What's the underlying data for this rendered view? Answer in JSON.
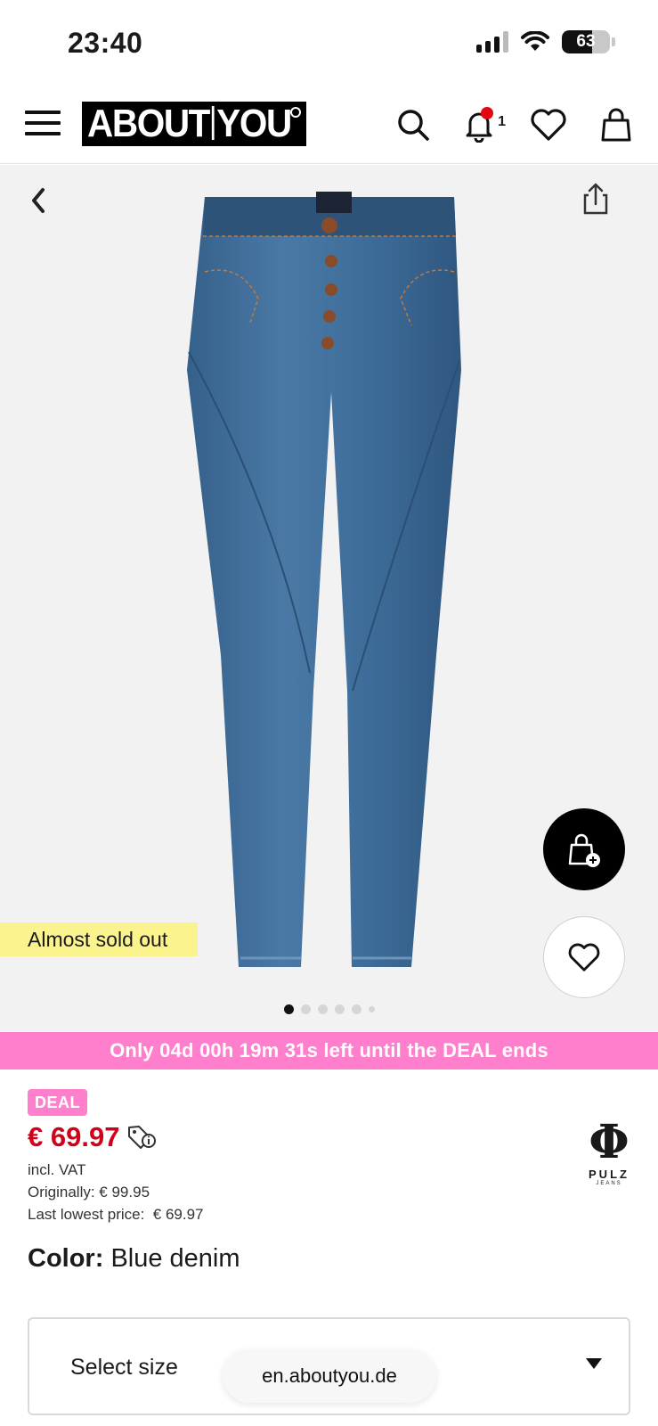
{
  "status_bar": {
    "time": "23:40",
    "battery": "63",
    "battery_level": 0.63
  },
  "header": {
    "logo": "ABOUT YOU",
    "logo_part1": "ABOUT",
    "logo_part2": "YOU",
    "notification_count": "1"
  },
  "gallery": {
    "badge": "Almost sold out",
    "image_count": 6,
    "active_index": 0
  },
  "deal_banner": "Only 04d 00h 19m 31s left until the DEAL ends",
  "pricing": {
    "deal_badge": "DEAL",
    "price": "€ 69.97",
    "vat": "incl. VAT",
    "original": "Originally: € 99.95",
    "lowest": "Last lowest price:  € 69.97"
  },
  "brand": {
    "symbol": "Φ",
    "name": "PULZ",
    "sub": "JEANS"
  },
  "color": {
    "label": "Color:",
    "value": "Blue denim"
  },
  "size_select": {
    "label": "Select size"
  },
  "browser": {
    "url": "en.aboutyou.de"
  },
  "colors": {
    "deal_pink": "#ff7fcc",
    "price_red": "#d0021b",
    "sold_out_yellow": "#fbf48e"
  }
}
